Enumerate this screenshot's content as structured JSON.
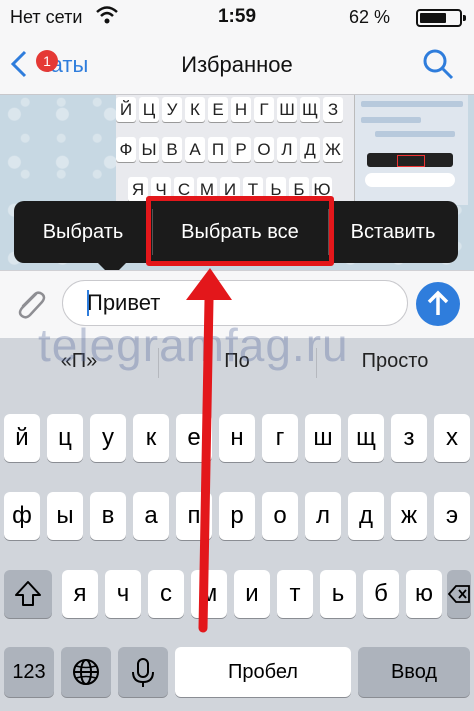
{
  "status": {
    "carrier": "Нет сети",
    "time": "1:59",
    "battery": "62 %"
  },
  "nav": {
    "back_label": "Чаты",
    "badge": "1",
    "title": "Избранное"
  },
  "thumbnail": {
    "rows": [
      [
        "Й",
        "Ц",
        "У",
        "К",
        "Е",
        "Н",
        "Г",
        "Ш",
        "Щ",
        "З"
      ],
      [
        "Ф",
        "Ы",
        "В",
        "А",
        "П",
        "Р",
        "О",
        "Л",
        "Д",
        "Ж"
      ],
      [
        "Я",
        "Ч",
        "С",
        "М",
        "И",
        "Т",
        "Ь",
        "Б",
        "Ю"
      ]
    ]
  },
  "context_menu": {
    "items": [
      "Выбрать",
      "Выбрать все",
      "Вставить"
    ],
    "highlighted": "Выбрать все"
  },
  "input": {
    "value": "Привет"
  },
  "suggestions": [
    "«П»",
    "По",
    "Просто"
  ],
  "watermark": "telegramfag.ru",
  "keyboard": {
    "row1": [
      "й",
      "ц",
      "у",
      "к",
      "е",
      "н",
      "г",
      "ш",
      "щ",
      "з",
      "х"
    ],
    "row2": [
      "ф",
      "ы",
      "в",
      "а",
      "п",
      "р",
      "о",
      "л",
      "д",
      "ж",
      "э"
    ],
    "row3": [
      "я",
      "ч",
      "с",
      "м",
      "и",
      "т",
      "ь",
      "б",
      "ю"
    ],
    "numbers": "123",
    "space": "Пробел",
    "enter": "Ввод"
  },
  "colors": {
    "accent": "#2f7ddc",
    "highlight": "#e3171b",
    "badge": "#e53935"
  }
}
